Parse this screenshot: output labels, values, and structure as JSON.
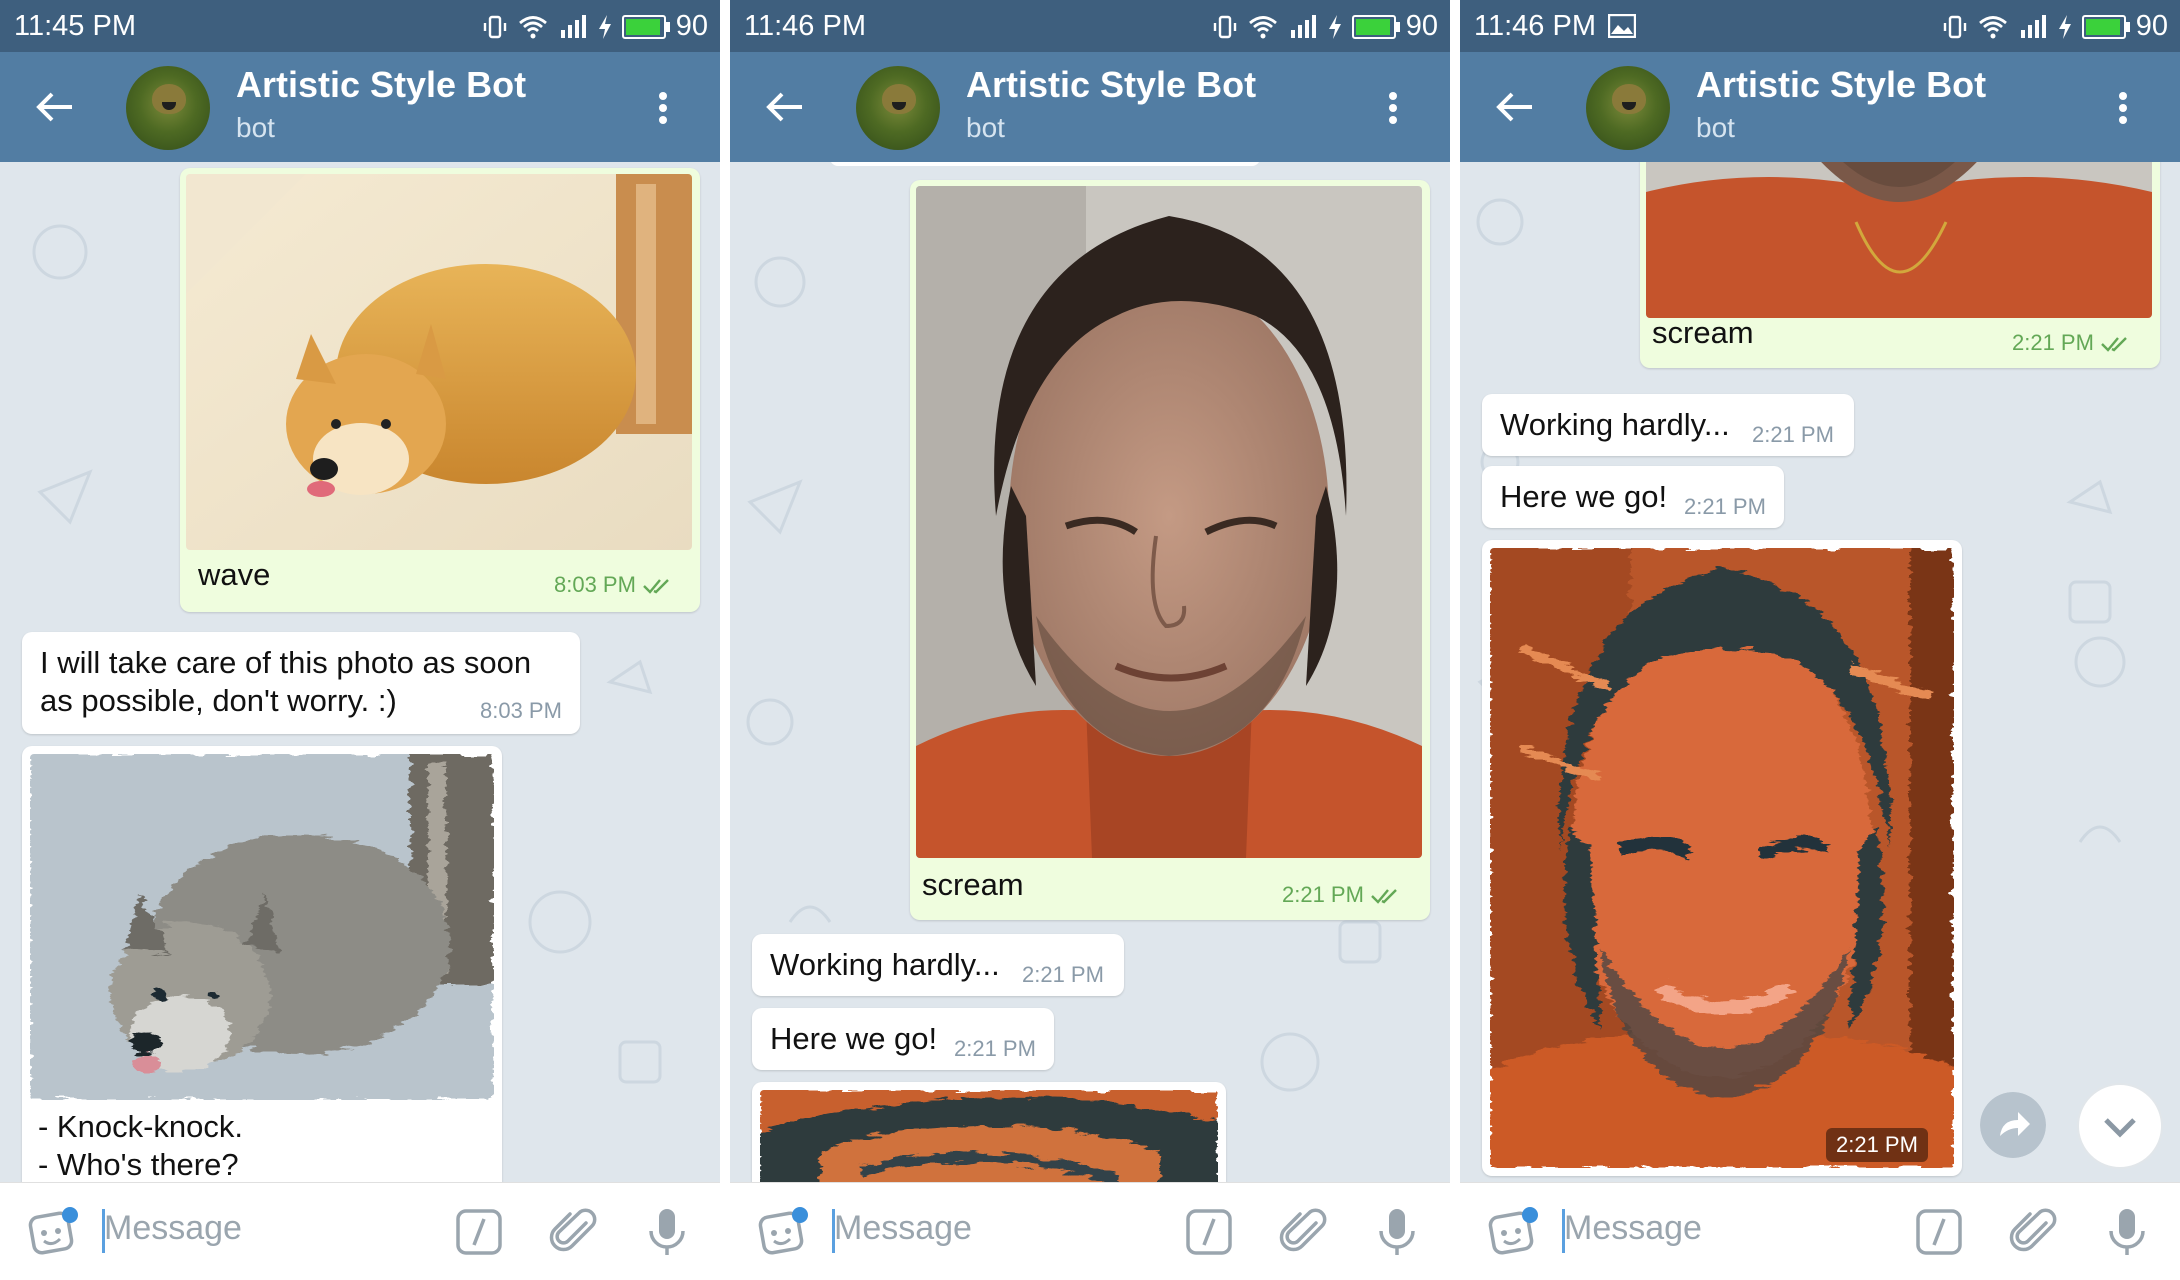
{
  "panels": [
    {
      "status_time": "11:45 PM",
      "battery": "90",
      "battery_level": 0.9,
      "chat_title": "Artistic Style Bot",
      "chat_subtitle": "bot",
      "messages": {
        "wave_caption": "wave",
        "wave_time": "8:03 PM",
        "care_line1": "I will take care of this photo as soon",
        "care_line2": "as possible, don't worry. :)",
        "care_time": "8:03 PM",
        "knock_line1": "- Knock-knock.",
        "knock_line2": "- Who's there?"
      },
      "composer_placeholder": "Message"
    },
    {
      "status_time": "11:46 PM",
      "battery": "90",
      "battery_level": 0.9,
      "chat_title": "Artistic Style Bot",
      "chat_subtitle": "bot",
      "messages": {
        "scream_caption": "scream",
        "scream_time": "2:21 PM",
        "working_text": "Working hardly...",
        "working_time": "2:21 PM",
        "herewego_text": "Here we go!",
        "herewego_time": "2:21 PM"
      },
      "composer_placeholder": "Message"
    },
    {
      "status_time": "11:46 PM",
      "battery": "90",
      "battery_level": 0.9,
      "chat_title": "Artistic Style Bot",
      "chat_subtitle": "bot",
      "messages": {
        "scream_caption": "scream",
        "scream_time": "2:21 PM",
        "working_text": "Working hardly...",
        "working_time": "2:21 PM",
        "herewego_text": "Here we go!",
        "herewego_time": "2:21 PM",
        "result_time": "2:21 PM"
      },
      "composer_placeholder": "Message"
    }
  ],
  "icons": {
    "vibrate": "vibrate-icon",
    "wifi": "wifi-icon",
    "signal": "signal-icon",
    "charging": "charging-icon",
    "gallery": "image-notification-icon",
    "back": "back-arrow-icon",
    "menu": "more-vert-icon",
    "sticker": "sticker-icon",
    "command": "bot-command-icon",
    "attach": "attach-icon",
    "mic": "microphone-icon",
    "share": "share-icon",
    "scroll_down": "chevron-down-icon"
  },
  "colors": {
    "status_bar": "#3e5f7e",
    "header": "#527da3",
    "chat_bg": "#dfe6ec",
    "outgoing_bubble": "#effdde",
    "incoming_bubble": "#ffffff",
    "read_checks": "#63a856"
  }
}
